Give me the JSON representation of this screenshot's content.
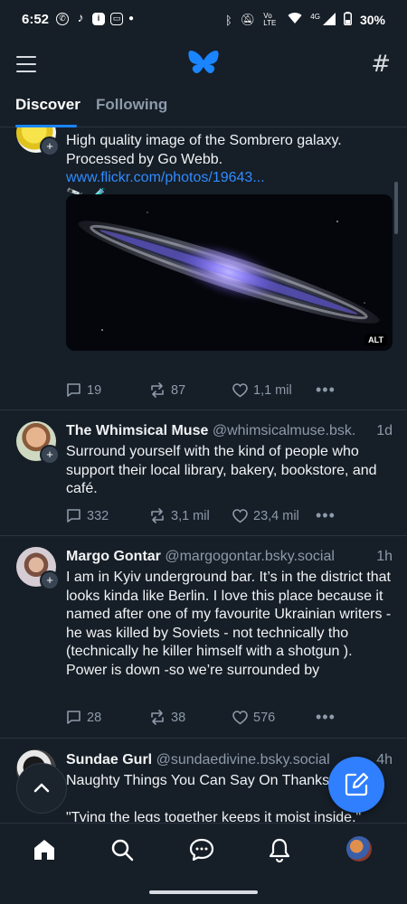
{
  "status_bar": {
    "time": "6:52",
    "network": "Vo LTE",
    "signal": "4G",
    "battery": "30%"
  },
  "tabs": [
    {
      "label": "Discover"
    },
    {
      "label": "Following"
    }
  ],
  "posts": [
    {
      "text": "High quality image of the Sombrero galaxy. Processed by Go Webb.",
      "link": "www.flickr.com/photos/19643...",
      "emoji": "🔭 🧪",
      "image_alt_badge": "ALT",
      "replies": "19",
      "reposts": "87",
      "likes": "1,1 mil"
    },
    {
      "name": "The Whimsical Muse",
      "handle": "@whimsicalmuse.bsk...",
      "time": "1d",
      "text": "Surround yourself with the kind of people who support their local library, bakery, bookstore, and café.",
      "replies": "332",
      "reposts": "3,1 mil",
      "likes": "23,4 mil"
    },
    {
      "name": "Margo Gontar",
      "handle": "@margogontar.bsky.social",
      "time": "1h",
      "text": "I am in Kyiv underground bar. It’s in the district that looks kinda like Berlin. I love this place because it named after one of my favourite Ukrainian writers - he was killed by Soviets - not technically tho (technically he killer himself with a shotgun ). Power is down -so we’re surrounded by",
      "replies": "28",
      "reposts": "38",
      "likes": "576"
    },
    {
      "name": "Sundae Gurl",
      "handle": "@sundaedivine.bsky.social",
      "time": "4h",
      "text_line1": "Naughty Things You Can Say On Thanksgiving:",
      "text_line2": "\"Tying the legs together keeps it moist inside.\""
    }
  ],
  "colors": {
    "background": "#161e27",
    "accent": "#2f7fff",
    "link": "#2f8cff",
    "muted": "#8d9aaa"
  }
}
